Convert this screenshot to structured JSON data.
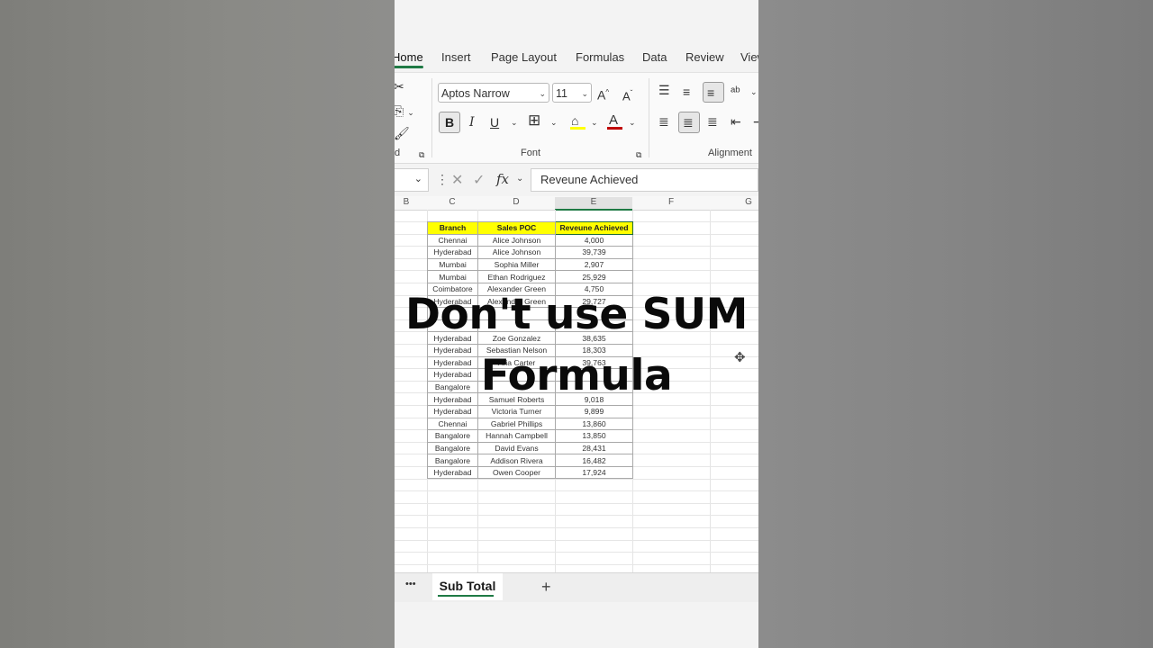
{
  "ribbon_tabs": [
    "Home",
    "Insert",
    "Page Layout",
    "Formulas",
    "Data",
    "Review",
    "View"
  ],
  "font": {
    "name": "Aptos Narrow",
    "size": "11",
    "group_label": "Font"
  },
  "clipboard_group_label": "d",
  "alignment_group_label": "Alignment",
  "formula_bar": {
    "fx": "fx",
    "content": "Reveune Achieved"
  },
  "columns": [
    "B",
    "C",
    "D",
    "E",
    "F",
    "G"
  ],
  "table": {
    "headers": [
      "Branch",
      "Sales POC",
      "Reveune Achieved"
    ],
    "rows": [
      [
        "Chennai",
        "Alice Johnson",
        "4,000"
      ],
      [
        "Hyderabad",
        "Alice Johnson",
        "39,739"
      ],
      [
        "Mumbai",
        "Sophia Miller",
        "2,907"
      ],
      [
        "Mumbai",
        "Ethan Rodriguez",
        "25,929"
      ],
      [
        "Coimbatore",
        "Alexander Green",
        "4,750"
      ],
      [
        "Hyderabad",
        "Alexander Green",
        "29,727"
      ],
      [
        "",
        "",
        ""
      ],
      [
        "",
        "",
        ""
      ],
      [
        "Hyderabad",
        "Zoe Gonzalez",
        "38,635"
      ],
      [
        "Hyderabad",
        "Sebastian Nelson",
        "18,303"
      ],
      [
        "Hyderabad",
        "Aria Carter",
        "39,763"
      ],
      [
        "Hyderabad",
        "",
        ""
      ],
      [
        "Bangalore",
        "",
        ""
      ],
      [
        "Hyderabad",
        "Samuel Roberts",
        "9,018"
      ],
      [
        "Hyderabad",
        "Victoria Turner",
        "9,899"
      ],
      [
        "Chennai",
        "Gabriel Phillips",
        "13,860"
      ],
      [
        "Bangalore",
        "Hannah Campbell",
        "13,850"
      ],
      [
        "Bangalore",
        "David Evans",
        "28,431"
      ],
      [
        "Bangalore",
        "Addison Rivera",
        "16,482"
      ],
      [
        "Hyderabad",
        "Owen Cooper",
        "17,924"
      ]
    ]
  },
  "caption": {
    "line1": "Don't use SUM",
    "line2": "Formula"
  },
  "sheet": {
    "more": "•••",
    "active_tab": "Sub Total",
    "add": "+"
  },
  "colors": {
    "header_fill": "#ffff00",
    "accent": "#1f7a45",
    "font_color_bar": "#c00000",
    "fill_color_bar": "#ffff00"
  }
}
